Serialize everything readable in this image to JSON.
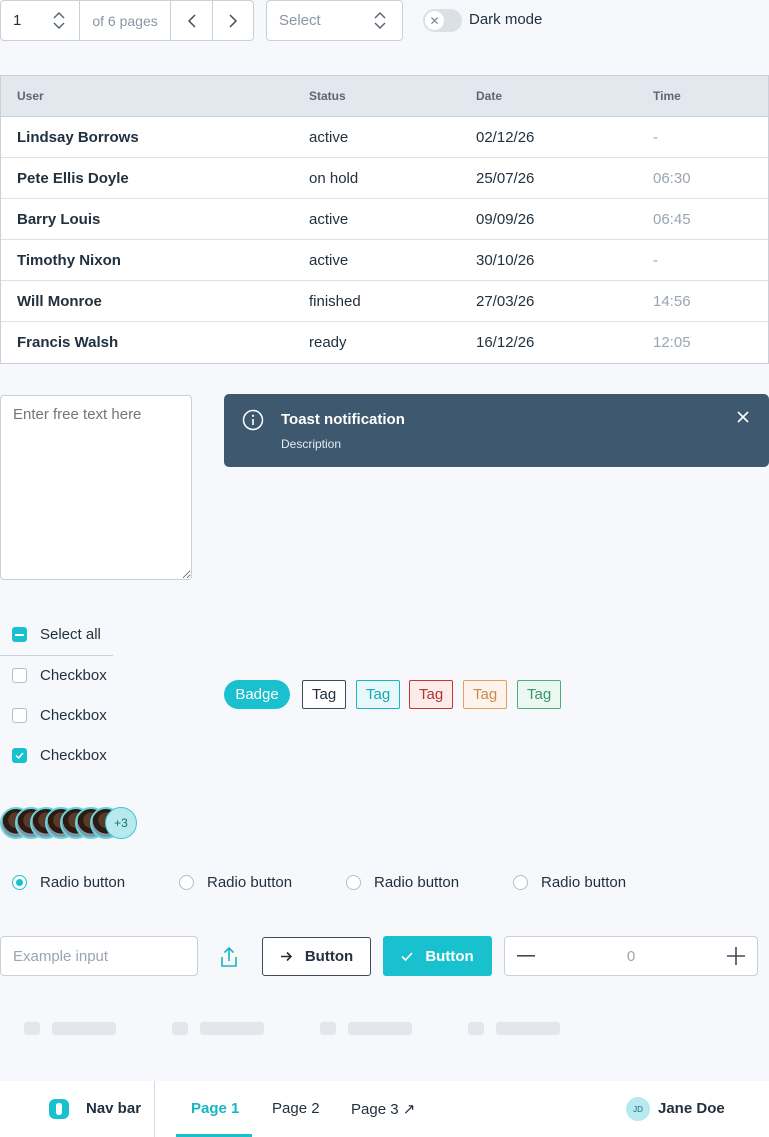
{
  "pagination": {
    "current": "1",
    "of_label": "of 6 pages"
  },
  "select": {
    "placeholder": "Select"
  },
  "toggle": {
    "label": "Dark mode",
    "on": false
  },
  "table": {
    "headers": [
      "User",
      "Status",
      "Date",
      "Time"
    ],
    "rows": [
      [
        "Lindsay Borrows",
        "active",
        "02/12/26",
        "-"
      ],
      [
        "Pete Ellis Doyle",
        "on hold",
        "25/07/26",
        "06:30"
      ],
      [
        "Barry Louis",
        "active",
        "09/09/26",
        "06:45"
      ],
      [
        "Timothy Nixon",
        "active",
        "30/10/26",
        "-"
      ],
      [
        "Will Monroe",
        "finished",
        "27/03/26",
        "14:56"
      ],
      [
        "Francis Walsh",
        "ready",
        "16/12/26",
        "12:05"
      ]
    ]
  },
  "textarea": {
    "placeholder": "Enter free text here"
  },
  "toast": {
    "title": "Toast notification",
    "description": "Description"
  },
  "checkboxes": {
    "select_all": "Select all",
    "items": [
      {
        "label": "Checkbox",
        "checked": false
      },
      {
        "label": "Checkbox",
        "checked": false
      },
      {
        "label": "Checkbox",
        "checked": true
      }
    ]
  },
  "badge": {
    "label": "Badge"
  },
  "tags": [
    {
      "label": "Tag",
      "color": "#3e4c58"
    },
    {
      "label": "Tag",
      "color": "#19b5c2"
    },
    {
      "label": "Tag",
      "color": "#c0392b"
    },
    {
      "label": "Tag",
      "color": "#e0a060"
    },
    {
      "label": "Tag",
      "color": "#4caf7a"
    }
  ],
  "avatars": {
    "more_label": "+3"
  },
  "radios": [
    {
      "label": "Radio button",
      "selected": true
    },
    {
      "label": "Radio button",
      "selected": false
    },
    {
      "label": "Radio button",
      "selected": false
    },
    {
      "label": "Radio button",
      "selected": false
    }
  ],
  "form": {
    "input_placeholder": "Example input",
    "button_outline": "Button",
    "button_primary": "Button",
    "stepper_value": "0"
  },
  "navbar": {
    "brand": "Nav bar",
    "links": [
      "Page 1",
      "Page 2",
      "Page 3 ↗"
    ],
    "user_initials": "JD",
    "user_name": "Jane Doe"
  },
  "colors": {
    "accent": "#19c1cf",
    "toast_bg": "#3e586f"
  }
}
